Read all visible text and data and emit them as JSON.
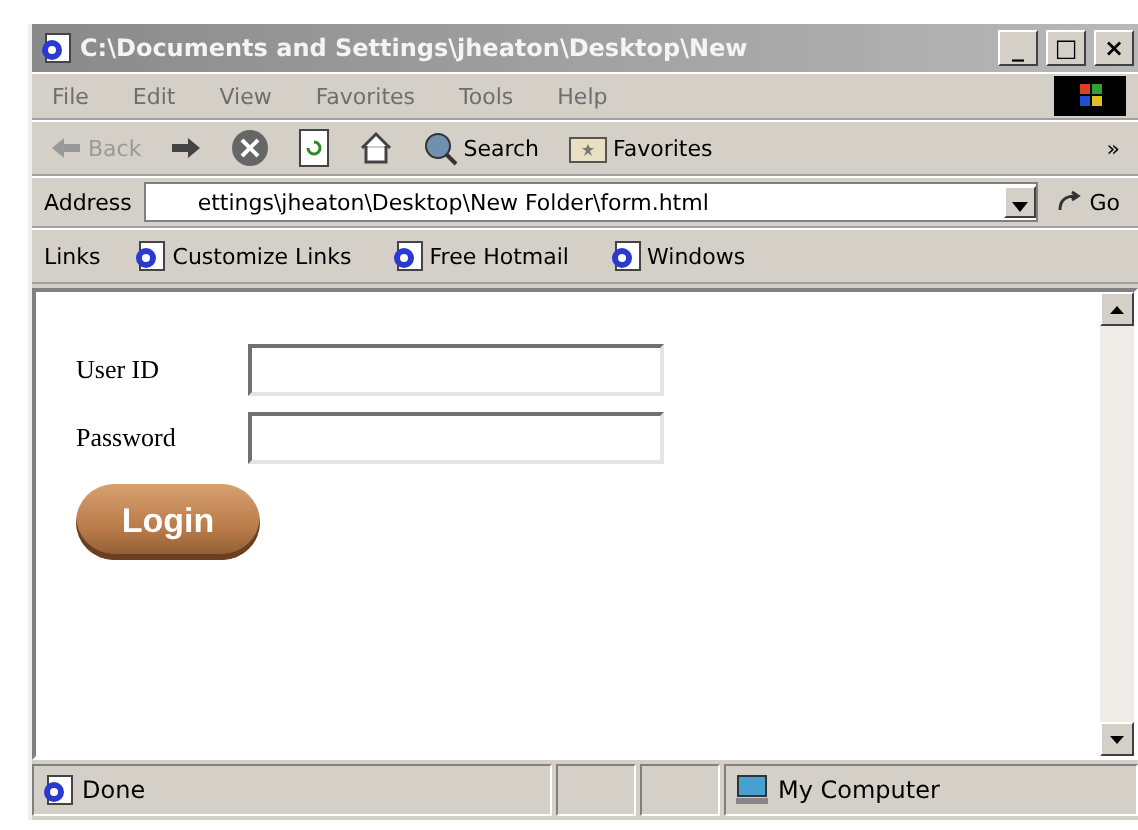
{
  "window": {
    "title": "C:\\Documents and Settings\\jheaton\\Desktop\\New",
    "controls": [
      "_",
      "□",
      "×"
    ]
  },
  "menu": [
    "File",
    "Edit",
    "View",
    "Favorites",
    "Tools",
    "Help"
  ],
  "toolbar": [
    {
      "kind": "back",
      "label": "Back",
      "disabled": true
    },
    {
      "kind": "forward",
      "disabled": false
    },
    {
      "kind": "stop",
      "disabled": false
    },
    {
      "kind": "refresh",
      "disabled": false
    },
    {
      "kind": "home",
      "disabled": false
    },
    {
      "kind": "search",
      "label": "Search",
      "disabled": false
    },
    {
      "kind": "favorites",
      "label": "Favorites",
      "disabled": false
    }
  ],
  "toolbar_more": "»",
  "address": {
    "label": "Address",
    "value": "ettings\\jheaton\\Desktop\\New Folder\\form.html",
    "go": "Go"
  },
  "links": {
    "label": "Links",
    "items": [
      "Customize Links",
      "Free Hotmail",
      "Windows"
    ]
  },
  "form": {
    "fields": [
      {
        "label": "User ID"
      },
      {
        "label": "Password"
      }
    ],
    "button": "Login"
  },
  "status_bar": {
    "text": "Done",
    "zone": "My Computer"
  }
}
